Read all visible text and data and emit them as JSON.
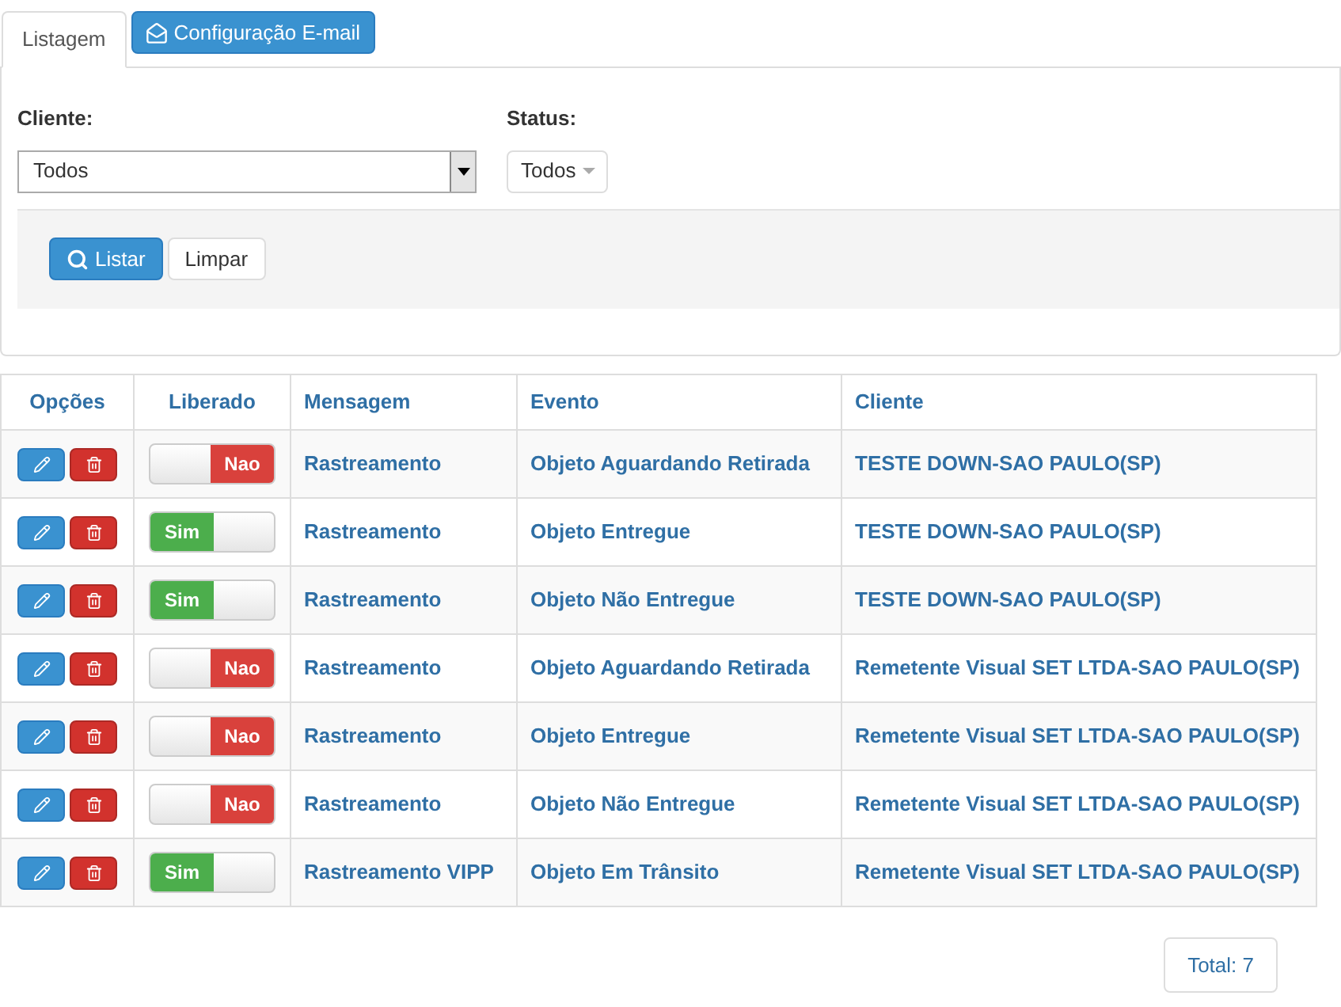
{
  "tabs": [
    {
      "label": "Listagem",
      "selected": true
    },
    {
      "label": "Configuração E-mail",
      "selected": false
    }
  ],
  "filters": {
    "cliente": {
      "label": "Cliente:",
      "value": "Todos"
    },
    "status": {
      "label": "Status:",
      "value": "Todos"
    }
  },
  "buttons": {
    "listar": "Listar",
    "limpar": "Limpar"
  },
  "table": {
    "columns": [
      "Opções",
      "Liberado",
      "Mensagem",
      "Evento",
      "Cliente"
    ],
    "rows": [
      {
        "on": false,
        "toggle_label": "Nao",
        "mensagem": "Rastreamento",
        "evento": "Objeto Aguardando Retirada",
        "cliente": "TESTE DOWN-SAO PAULO(SP)"
      },
      {
        "on": true,
        "toggle_label": "Sim",
        "mensagem": "Rastreamento",
        "evento": "Objeto Entregue",
        "cliente": "TESTE DOWN-SAO PAULO(SP)"
      },
      {
        "on": true,
        "toggle_label": "Sim",
        "mensagem": "Rastreamento",
        "evento": "Objeto Não Entregue",
        "cliente": "TESTE DOWN-SAO PAULO(SP)"
      },
      {
        "on": false,
        "toggle_label": "Nao",
        "mensagem": "Rastreamento",
        "evento": "Objeto Aguardando Retirada",
        "cliente": "Remetente Visual SET LTDA-SAO PAULO(SP)"
      },
      {
        "on": false,
        "toggle_label": "Nao",
        "mensagem": "Rastreamento",
        "evento": "Objeto Entregue",
        "cliente": "Remetente Visual SET LTDA-SAO PAULO(SP)"
      },
      {
        "on": false,
        "toggle_label": "Nao",
        "mensagem": "Rastreamento",
        "evento": "Objeto Não Entregue",
        "cliente": "Remetente Visual SET LTDA-SAO PAULO(SP)"
      },
      {
        "on": true,
        "toggle_label": "Sim",
        "mensagem": "Rastreamento VIPP",
        "evento": "Objeto Em Trânsito",
        "cliente": "Remetente Visual SET LTDA-SAO PAULO(SP)"
      }
    ]
  },
  "total": "Total: 7"
}
